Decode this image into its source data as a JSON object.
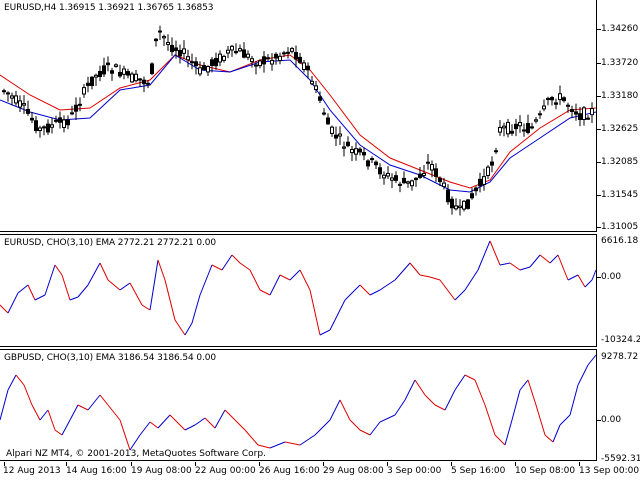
{
  "main_pane": {
    "title": "EURUSD,H4  1.36915 1.36921 1.36765 1.36853",
    "price_labels": [
      "1.34260",
      "1.33720",
      "1.33180",
      "1.32625",
      "1.32085",
      "1.31545",
      "1.31005"
    ],
    "colors": {
      "ma_red": "#e00000",
      "ma_blue": "#0000d0",
      "candle": "#000000"
    }
  },
  "ind1": {
    "title": "EURUSD, CHO(3,10) EMA 2772.21 2772.21 0.00",
    "scale_labels": [
      "6616.18",
      "0.00",
      "-10324.27"
    ]
  },
  "ind2": {
    "title": "GBPUSD, CHO(3,10) EMA 3186.54 3186.54 0.00",
    "scale_labels": [
      "9278.72",
      "0.00",
      "-5592.31"
    ]
  },
  "footer": {
    "copyright": "Alpari NZ MT4, © 2001-2013, MetaQuotes Software Corp.",
    "time_labels": [
      "12 Aug 2013",
      "14 Aug 16:00",
      "19 Aug 08:00",
      "22 Aug 00:00",
      "26 Aug 16:00",
      "29 Aug 08:00",
      "3 Sep 00:00",
      "5 Sep 16:00",
      "10 Sep 08:00",
      "13 Sep 00:00"
    ]
  }
}
